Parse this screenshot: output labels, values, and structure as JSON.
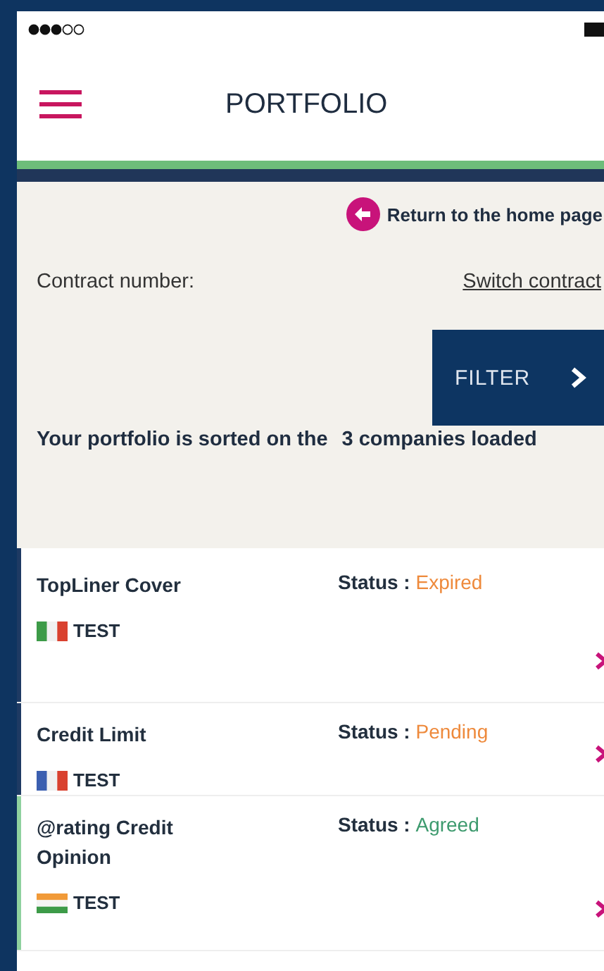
{
  "header": {
    "title": "PORTFOLIO"
  },
  "return_link": {
    "label": "Return to the home page"
  },
  "contract": {
    "label": "Contract number:",
    "switch_link": "Switch contract"
  },
  "filter_button": {
    "label": "FILTER"
  },
  "summary": {
    "sort_text": "Your portfolio is sorted on the",
    "count_text": "3 companies loaded"
  },
  "policies": [
    {
      "name": "TopLiner Cover",
      "status_label": "Status :",
      "status": {
        "label": "Expired",
        "color": "#ee8a3c"
      },
      "color": "#1e3a63",
      "kind": "it",
      "company": "TEST"
    },
    {
      "name": "Credit Limit",
      "status_label": "Status :",
      "status": {
        "label": "Pending",
        "color": "#ee8a3c"
      },
      "color": "#1e3a63",
      "kind": "fr",
      "company": "TEST"
    },
    {
      "name": "@rating Credit Opinion",
      "status_label": "Status :",
      "status": {
        "label": "Agreed",
        "color": "#3d9a6e"
      },
      "color": "#8fd19e",
      "kind": "in",
      "company": "TEST"
    }
  ]
}
